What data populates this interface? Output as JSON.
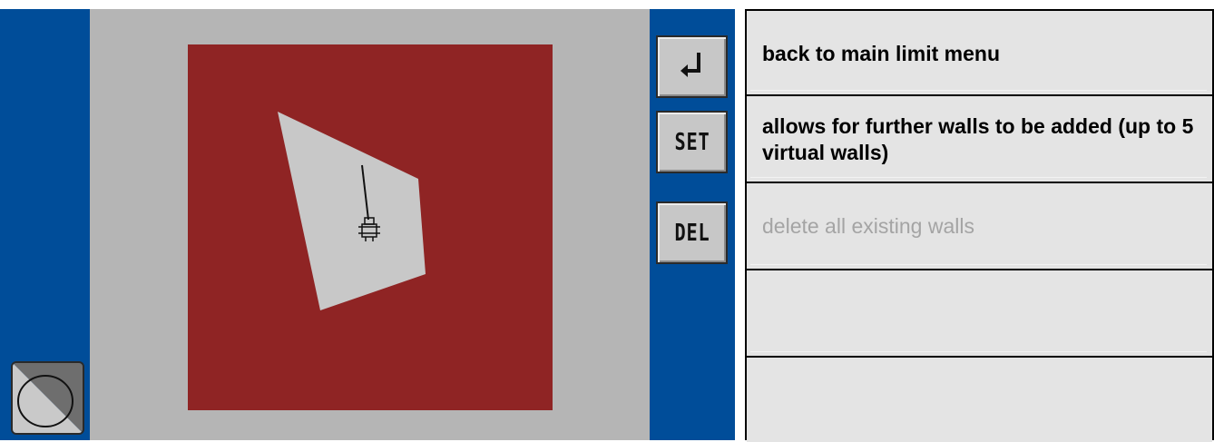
{
  "screen": {
    "colors": {
      "frame": "#004d99",
      "canvas": "#b5b5b5",
      "work_area": "#8f2424",
      "wall_zone": "#c8c8c8"
    },
    "buttons": [
      {
        "id": "back",
        "label": "↲",
        "icon": "return-arrow-icon"
      },
      {
        "id": "set",
        "label": "SET"
      },
      {
        "id": "del",
        "label": "DEL"
      }
    ],
    "corner_button": {
      "icon": "circle-icon"
    }
  },
  "descriptions": [
    {
      "text": "back to main limit menu",
      "enabled": true
    },
    {
      "text": "allows for further walls to be added (up to 5 virtual walls)",
      "enabled": true
    },
    {
      "text": "delete all existing walls",
      "enabled": false
    },
    {
      "text": "",
      "enabled": false
    },
    {
      "text": "",
      "enabled": false
    }
  ]
}
